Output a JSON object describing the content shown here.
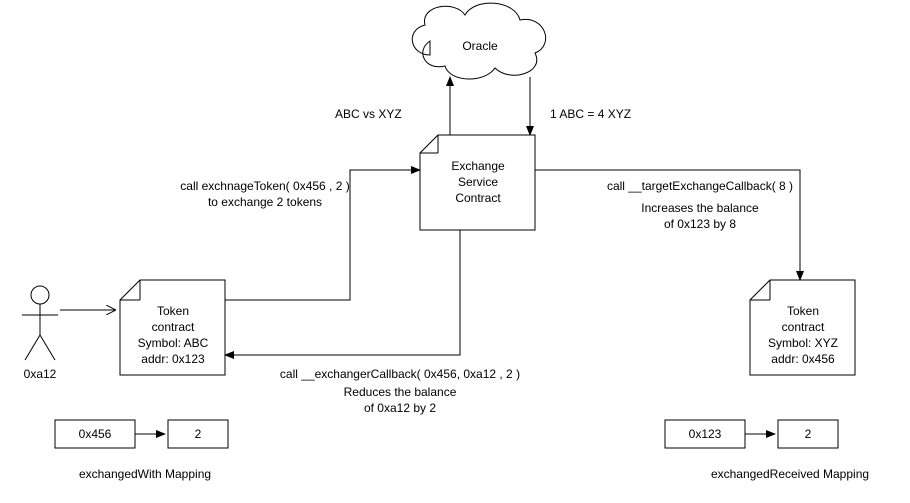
{
  "oracle": {
    "label": "Oracle"
  },
  "oracle_query": "ABC vs XYZ",
  "oracle_rate": "1 ABC = 4 XYZ",
  "exchange_node": {
    "line1": "Exchange",
    "line2": "Service",
    "line3": "Contract"
  },
  "left_call": {
    "line1": "call exchnageToken( 0x456 , 2 )",
    "line2": "to exchange 2 tokens"
  },
  "right_call": {
    "line1": "call __targetExchangeCallback( 8 )",
    "line2": "Increases the balance",
    "line3": "of 0x123 by 8"
  },
  "center_call": {
    "line1": "call __exchangerCallback( 0x456, 0xa12 , 2 )",
    "line2": "Reduces the balance",
    "line3": "of 0xa12 by 2"
  },
  "actor": {
    "label": "0xa12"
  },
  "token_abc": {
    "line1": "Token",
    "line2": "contract",
    "line3": "Symbol: ABC",
    "line4": "addr: 0x123"
  },
  "token_xyz": {
    "line1": "Token",
    "line2": "contract",
    "line3": "Symbol: XYZ",
    "line4": "addr: 0x456"
  },
  "left_map": {
    "key": "0x456",
    "val": "2",
    "caption": "exchangedWith Mapping"
  },
  "right_map": {
    "key": "0x123",
    "val": "2",
    "caption": "exchangedReceived Mapping"
  }
}
